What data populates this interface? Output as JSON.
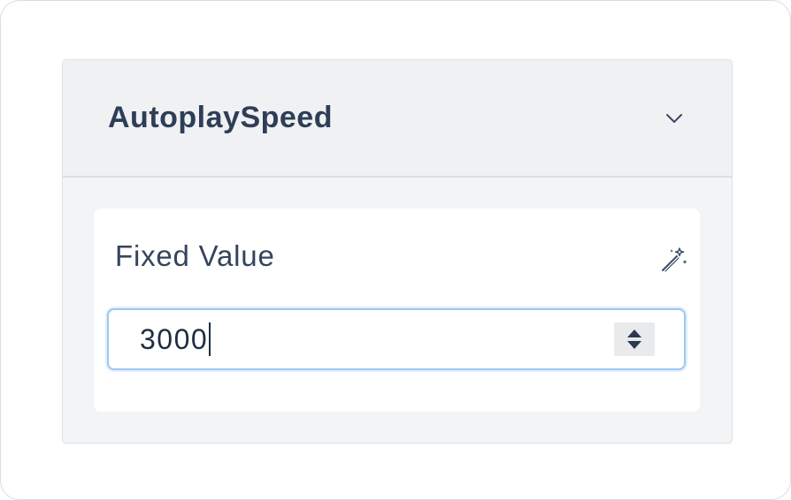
{
  "panel": {
    "title": "AutoplaySpeed",
    "toggle_icon": "chevron-down-icon"
  },
  "field": {
    "label": "Fixed Value",
    "action_icon": "magic-wand-icon",
    "value": "3000",
    "spinner_icon": "up-down-arrows-icon"
  },
  "colors": {
    "title_text": "#2e3e57",
    "header_bg": "#f0f1f3",
    "input_focus_border": "#9cc8f0"
  }
}
